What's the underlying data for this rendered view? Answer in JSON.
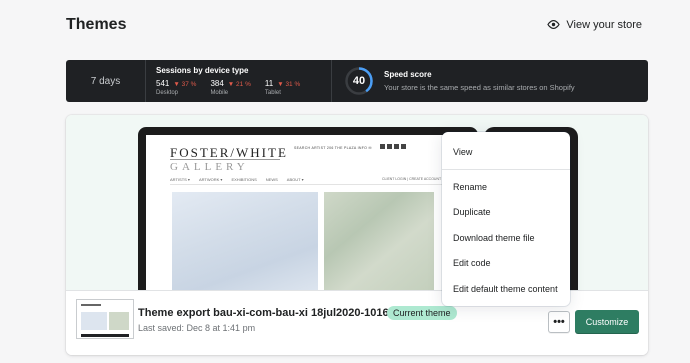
{
  "header": {
    "title": "Themes",
    "view_store_label": "View your store",
    "view_store_icon": "eye-icon"
  },
  "stats": {
    "period": "7 days",
    "sessions": {
      "title": "Sessions by device type",
      "devices": [
        {
          "value": "541",
          "change": "37 %",
          "label": "Desktop"
        },
        {
          "value": "384",
          "change": "21 %",
          "label": "Mobile"
        },
        {
          "value": "11",
          "change": "31 %",
          "label": "Tablet"
        }
      ],
      "change_direction": "down",
      "change_color": "#e15b4b"
    },
    "speed": {
      "score": "40",
      "score_fraction": 0.4,
      "title": "Speed score",
      "description": "Your store is the same speed as similar stores on Shopify",
      "gauge_color": "#4b9ef5"
    }
  },
  "preview": {
    "site": {
      "logo_line1": "FOSTER/WHITE",
      "logo_line2": "GALLERY",
      "topbar": "SEARCH ARTIST   206 THE PLAZA   INFO   ✉",
      "nav": [
        "ARTISTS ▾",
        "ARTWORK ▾",
        "EXHIBITIONS",
        "NEWS",
        "ABOUT ▾"
      ],
      "nav_right": "CLIENT LOGIN  |  CREATE ACCOUNT"
    }
  },
  "theme": {
    "name": "Theme export bau-xi-com-bau-xi 18jul2020-1016…",
    "badge": "Current theme",
    "last_saved": "Last saved: Dec 8 at 1:41 pm",
    "more_label": "•••",
    "customize_label": "Customize"
  },
  "menu": {
    "items": [
      "View",
      "Rename",
      "Duplicate",
      "Download theme file",
      "Edit code",
      "Edit default theme content"
    ]
  },
  "colors": {
    "accent": "#2e7d62",
    "badge_bg": "#aee9d1",
    "dark_bar": "#1f2124"
  }
}
